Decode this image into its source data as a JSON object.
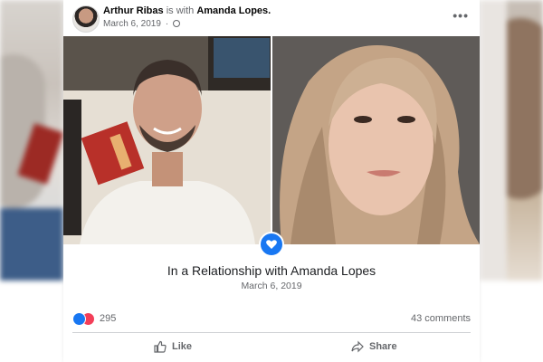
{
  "post": {
    "author": "Arthur Ribas",
    "with_text": "is with",
    "tagged": "Amanda Lopes.",
    "date": "March 6, 2019",
    "more_icon": "more-horizontal-icon",
    "privacy_icon": "globe-icon"
  },
  "event": {
    "icon": "relationship-heart-icon",
    "title": "In a Relationship with Amanda Lopes",
    "date": "March 6, 2019"
  },
  "stats": {
    "reactions_count": "295",
    "comments": "43 comments"
  },
  "actions": {
    "like": "Like",
    "share": "Share"
  },
  "colors": {
    "accent": "#1877f2",
    "love": "#f33e58",
    "secondary_text": "#65676b"
  }
}
